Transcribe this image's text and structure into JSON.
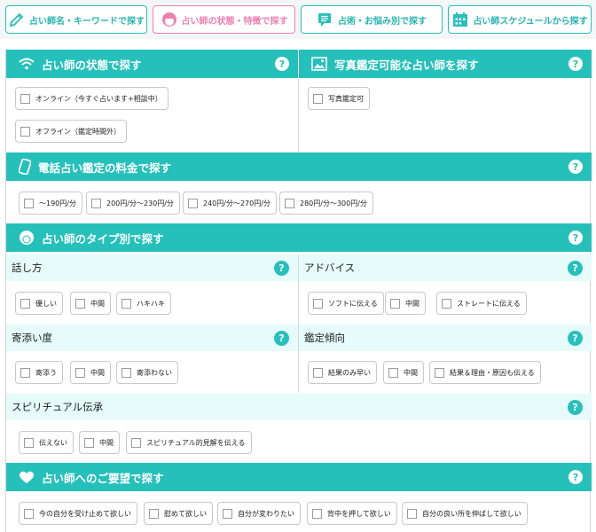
{
  "tabs": [
    {
      "label": "占い師名・キーワードで探す",
      "icon": "pencil-icon"
    },
    {
      "label": "占い師の状態・特徴で探す",
      "icon": "face-icon"
    },
    {
      "label": "占術・お悩み別で探す",
      "icon": "chat-list-icon"
    },
    {
      "label": "占い師スケジュールから探す",
      "icon": "calendar-icon"
    }
  ],
  "help_label": "?",
  "status": {
    "title": "占い師の状態で探す",
    "options": [
      "オンライン（今すぐ占います+相談中）",
      "オフライン（鑑定時間外）"
    ]
  },
  "photo": {
    "title": "写真鑑定可能な占い師を探す",
    "options": [
      "写真鑑定可"
    ]
  },
  "price": {
    "title": "電話占い鑑定の料金で探す",
    "options": [
      "〜190円/分",
      "200円/分〜230円/分",
      "240円/分〜270円/分",
      "280円/分〜300円/分"
    ]
  },
  "type": {
    "title": "占い師のタイプ別で探す",
    "speaking": {
      "label": "話し方",
      "options": [
        "優しい",
        "中間",
        "ハキハキ"
      ]
    },
    "advice": {
      "label": "アドバイス",
      "options": [
        "ソフトに伝える",
        "中間",
        "ストレートに伝える"
      ]
    },
    "empathy": {
      "label": "寄添い度",
      "options": [
        "寄添う",
        "中間",
        "寄添わない"
      ]
    },
    "tendency": {
      "label": "鑑定傾向",
      "options": [
        "結果のみ早い",
        "中間",
        "結果＆理由・原因も伝える"
      ]
    },
    "spiritual": {
      "label": "スピリチュアル伝承",
      "options": [
        "伝えない",
        "中間",
        "スピリチュアル的見解を伝える"
      ]
    }
  },
  "request": {
    "title": "占い師へのご要望で探す",
    "options": [
      "今の自分を受け止めて欲しい",
      "慰めて欲しい",
      "自分が変わりたい",
      "背中を押して欲しい",
      "自分の良い所を伸ばして欲しい"
    ]
  },
  "colors": {
    "accent": "#26c0bb",
    "active_tab": "#f07fb0",
    "subhead_bg": "#e7fbfb"
  }
}
